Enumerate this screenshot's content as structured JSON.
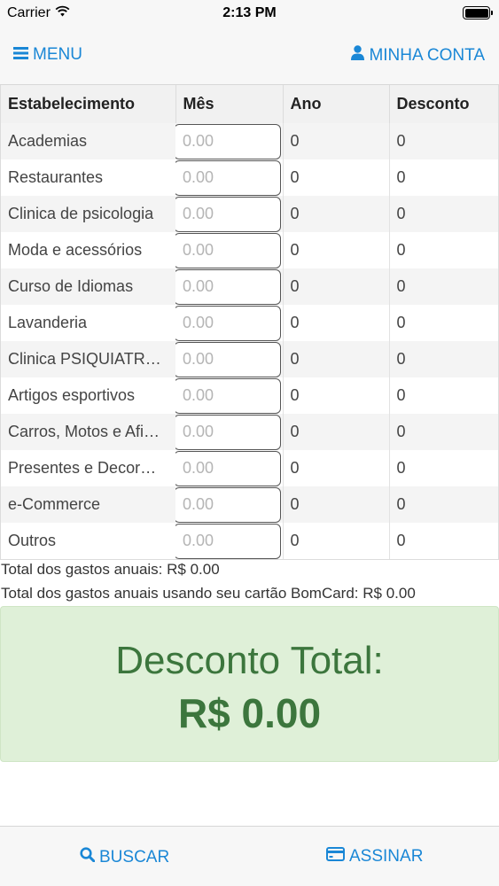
{
  "status_bar": {
    "carrier": "Carrier",
    "time": "2:13 PM"
  },
  "navbar": {
    "menu_label": "MENU",
    "account_label": "MINHA CONTA"
  },
  "table": {
    "headers": [
      "Estabelecimento",
      "Mês",
      "Ano",
      "Desconto"
    ],
    "rows": [
      {
        "name": "Academias",
        "mes_placeholder": "0.00",
        "ano": "0",
        "desconto": "0"
      },
      {
        "name": "Restaurantes",
        "mes_placeholder": "0.00",
        "ano": "0",
        "desconto": "0"
      },
      {
        "name": "Clinica de psicologia",
        "mes_placeholder": "0.00",
        "ano": "0",
        "desconto": "0"
      },
      {
        "name": "Moda e acessórios",
        "mes_placeholder": "0.00",
        "ano": "0",
        "desconto": "0"
      },
      {
        "name": "Curso de Idiomas",
        "mes_placeholder": "0.00",
        "ano": "0",
        "desconto": "0"
      },
      {
        "name": "Lavanderia",
        "mes_placeholder": "0.00",
        "ano": "0",
        "desconto": "0"
      },
      {
        "name": "Clinica PSIQUIATR…",
        "mes_placeholder": "0.00",
        "ano": "0",
        "desconto": "0"
      },
      {
        "name": "Artigos esportivos",
        "mes_placeholder": "0.00",
        "ano": "0",
        "desconto": "0"
      },
      {
        "name": "Carros, Motos e Afi…",
        "mes_placeholder": "0.00",
        "ano": "0",
        "desconto": "0"
      },
      {
        "name": "Presentes e Decor…",
        "mes_placeholder": "0.00",
        "ano": "0",
        "desconto": "0"
      },
      {
        "name": "e-Commerce",
        "mes_placeholder": "0.00",
        "ano": "0",
        "desconto": "0"
      },
      {
        "name": "Outros",
        "mes_placeholder": "0.00",
        "ano": "0",
        "desconto": "0"
      }
    ]
  },
  "totals": {
    "annual": "Total dos gastos anuais: R$ 0.00",
    "annual_bomcard": "Total dos gastos anuais usando seu cartão BomCard: R$ 0.00"
  },
  "discount": {
    "title": "Desconto Total:",
    "value": "R$ 0.00"
  },
  "tabbar": {
    "search_label": "BUSCAR",
    "subscribe_label": "ASSINAR"
  },
  "colors": {
    "accent": "#1a87d6",
    "success_bg": "#dff0d8",
    "success_text": "#3c763d"
  },
  "icons": [
    "wifi-icon",
    "battery-icon",
    "hamburger-menu-icon",
    "user-icon",
    "search-icon",
    "credit-card-icon"
  ]
}
